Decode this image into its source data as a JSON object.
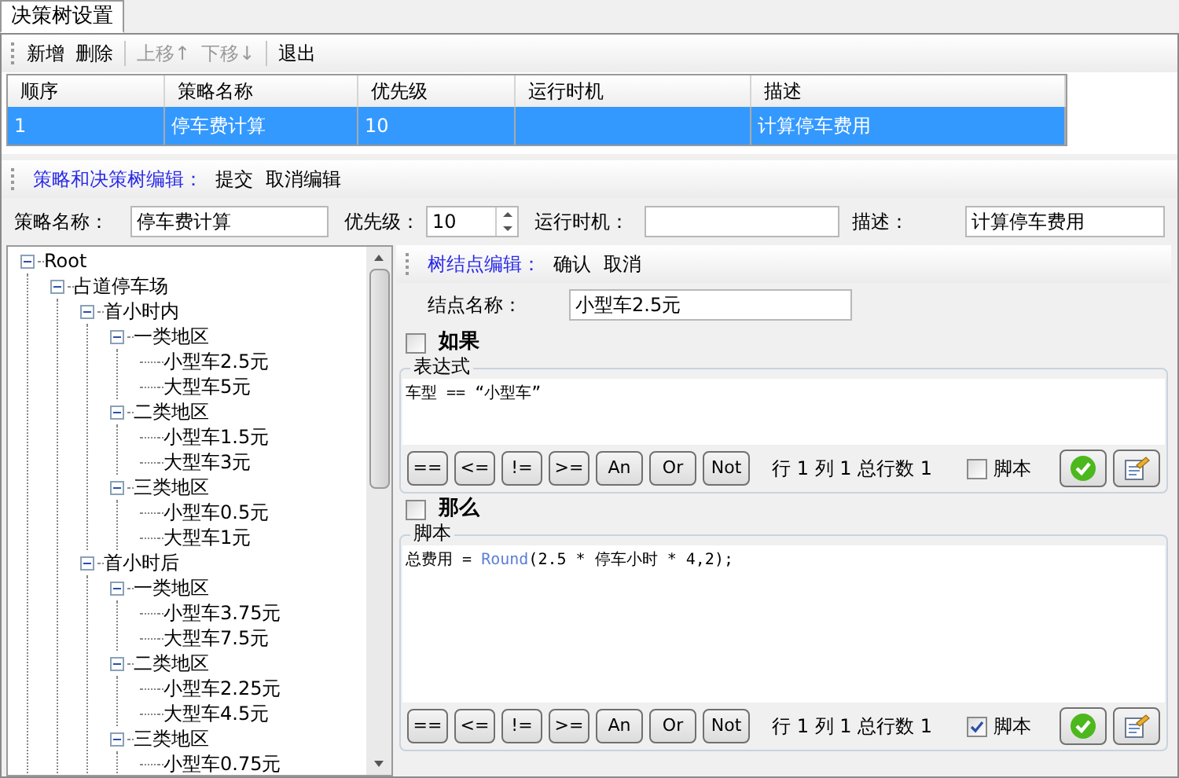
{
  "tabs": [
    {
      "label": "决策树设置",
      "selected": true
    }
  ],
  "toolbar": [
    {
      "label": "新增",
      "disabled": false
    },
    {
      "label": "删除",
      "disabled": false
    },
    {
      "label": "上移↑",
      "disabled": true
    },
    {
      "label": "下移↓",
      "disabled": true
    },
    {
      "label": "退出",
      "disabled": false
    }
  ],
  "table": {
    "columns": [
      "顺序",
      "策略名称",
      "优先级",
      "运行时机",
      "描述"
    ],
    "rows": [
      {
        "selected": true,
        "cells": [
          "1",
          "停车费计算",
          "10",
          "",
          "计算停车费用"
        ]
      }
    ]
  },
  "edit_bar": {
    "title": "策略和决策树编辑：",
    "actions": [
      "提交",
      "取消编辑"
    ]
  },
  "form": {
    "name_label": "策略名称：",
    "name_value": "停车费计算",
    "priority_label": "优先级：",
    "priority_value": "10",
    "timing_label": "运行时机：",
    "desc_label": "描述：",
    "desc_value": "计算停车费用"
  },
  "tree": [
    {
      "label": "Root",
      "expanded": true,
      "children": [
        {
          "label": "占道停车场",
          "expanded": true,
          "children": [
            {
              "label": "首小时内",
              "expanded": true,
              "children": [
                {
                  "label": "一类地区",
                  "expanded": true,
                  "children": [
                    {
                      "label": "小型车2.5元"
                    },
                    {
                      "label": "大型车5元"
                    }
                  ]
                },
                {
                  "label": "二类地区",
                  "expanded": true,
                  "children": [
                    {
                      "label": "小型车1.5元"
                    },
                    {
                      "label": "大型车3元"
                    }
                  ]
                },
                {
                  "label": "三类地区",
                  "expanded": true,
                  "children": [
                    {
                      "label": "小型车0.5元"
                    },
                    {
                      "label": "大型车1元"
                    }
                  ]
                }
              ]
            },
            {
              "label": "首小时后",
              "expanded": true,
              "children": [
                {
                  "label": "一类地区",
                  "expanded": true,
                  "children": [
                    {
                      "label": "小型车3.75元"
                    },
                    {
                      "label": "大型车7.5元"
                    }
                  ]
                },
                {
                  "label": "二类地区",
                  "expanded": true,
                  "children": [
                    {
                      "label": "小型车2.25元"
                    },
                    {
                      "label": "大型车4.5元"
                    }
                  ]
                },
                {
                  "label": "三类地区",
                  "expanded": true,
                  "children": [
                    {
                      "label": "小型车0.75元"
                    }
                  ]
                }
              ]
            }
          ]
        }
      ]
    }
  ],
  "node_editor": {
    "title": "树结点编辑：",
    "actions": [
      "确认",
      "取消"
    ],
    "name_label": "结点名称：",
    "name_value": "小型车2.5元",
    "sections": [
      {
        "label": "如果",
        "checked": false,
        "group": "表达式",
        "code": [
          {
            "kind": "text",
            "text": "车型 == “小型车”"
          }
        ],
        "operators": [
          "==",
          "<=",
          "!=",
          ">=",
          "An",
          "Or",
          "Not"
        ],
        "status": "行 1 列 1 总行数 1",
        "script_label": "脚本",
        "script_checked": false
      },
      {
        "label": "那么",
        "checked": false,
        "group": "脚本",
        "code": [
          {
            "kind": "text",
            "text": "总费用 = "
          },
          {
            "kind": "function",
            "text": "Round"
          },
          {
            "kind": "text",
            "text": "(2.5 * 停车小时 * 4,2);"
          }
        ],
        "operators": [
          "==",
          "<=",
          "!=",
          ">=",
          "An",
          "Or",
          "Not"
        ],
        "status": "行 1 列 1 总行数 1",
        "script_label": "脚本",
        "script_checked": true
      }
    ]
  }
}
